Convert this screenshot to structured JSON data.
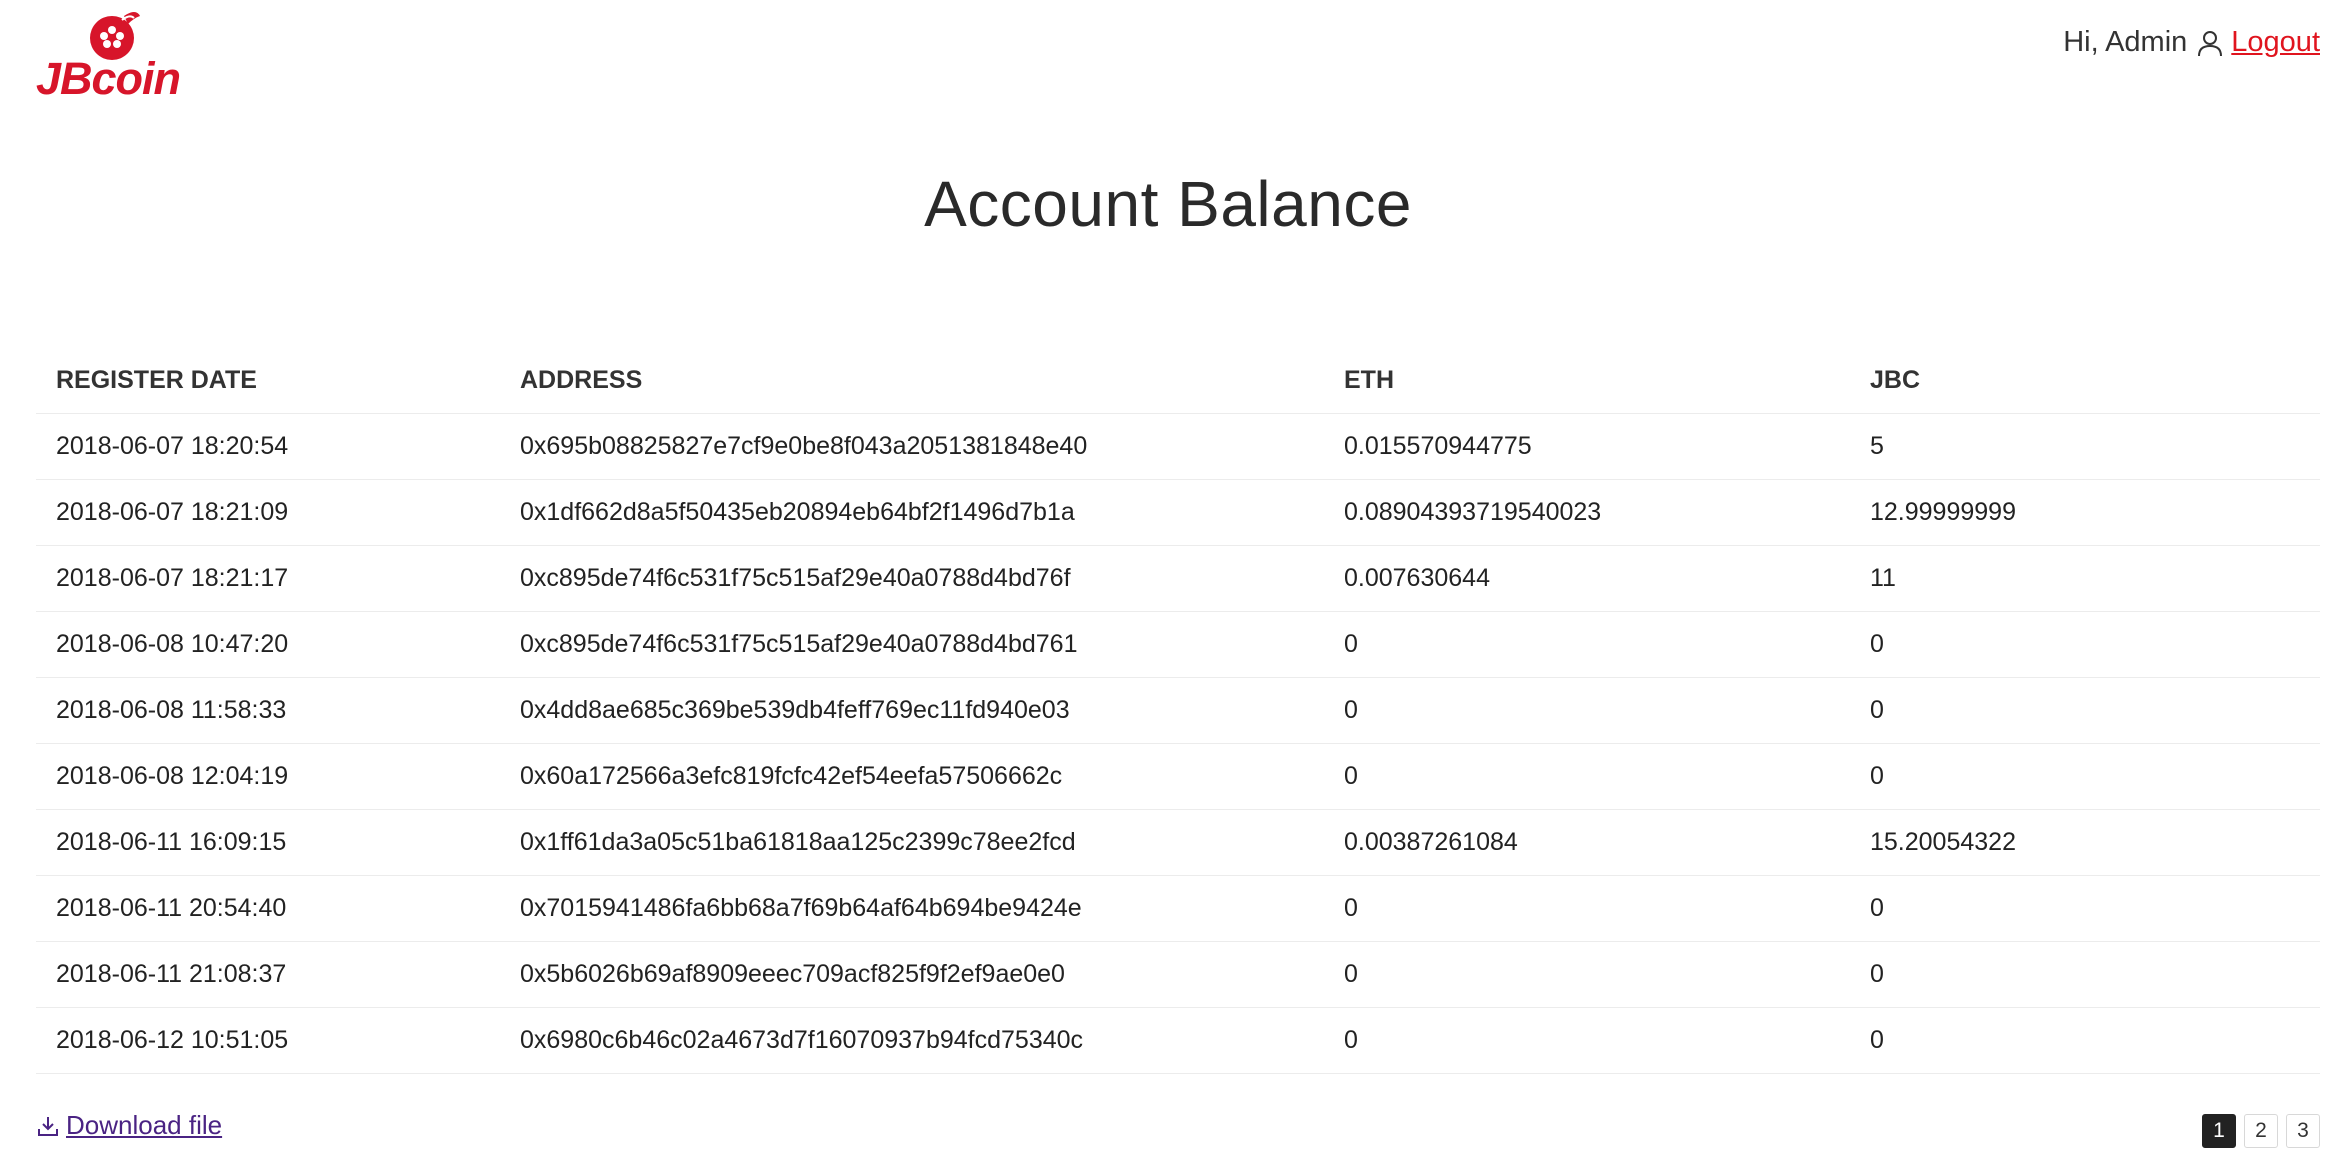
{
  "header": {
    "logo_text": "JBcoin",
    "greeting": "Hi, Admin",
    "logout_label": "Logout"
  },
  "title": "Account Balance",
  "table": {
    "columns": [
      "REGISTER DATE",
      "ADDRESS",
      "ETH",
      "JBC"
    ],
    "rows": [
      [
        "2018-06-07 18:20:54",
        "0x695b08825827e7cf9e0be8f043a2051381848e40",
        "0.015570944775",
        "5"
      ],
      [
        "2018-06-07 18:21:09",
        "0x1df662d8a5f50435eb20894eb64bf2f1496d7b1a",
        "0.08904393719540023",
        "12.99999999"
      ],
      [
        "2018-06-07 18:21:17",
        "0xc895de74f6c531f75c515af29e40a0788d4bd76f",
        "0.007630644",
        "11"
      ],
      [
        "2018-06-08 10:47:20",
        "0xc895de74f6c531f75c515af29e40a0788d4bd761",
        "0",
        "0"
      ],
      [
        "2018-06-08 11:58:33",
        "0x4dd8ae685c369be539db4feff769ec11fd940e03",
        "0",
        "0"
      ],
      [
        "2018-06-08 12:04:19",
        "0x60a172566a3efc819fcfc42ef54eefa57506662c",
        "0",
        "0"
      ],
      [
        "2018-06-11 16:09:15",
        "0x1ff61da3a05c51ba61818aa125c2399c78ee2fcd",
        "0.00387261084",
        "15.20054322"
      ],
      [
        "2018-06-11 20:54:40",
        "0x7015941486fa6bb68a7f69b64af64b694be9424e",
        "0",
        "0"
      ],
      [
        "2018-06-11 21:08:37",
        "0x5b6026b69af8909eeec709acf825f9f2ef9ae0e0",
        "0",
        "0"
      ],
      [
        "2018-06-12 10:51:05",
        "0x6980c6b46c02a4673d7f16070937b94fcd75340c",
        "0",
        "0"
      ]
    ]
  },
  "footer": {
    "download_label": "Download file",
    "pages": [
      "1",
      "2",
      "3"
    ],
    "current_page": "1"
  },
  "colors": {
    "brand": "#d7152a",
    "logout": "#e0141e",
    "download_link": "#4a2383",
    "active_page_bg": "#222222"
  },
  "icons": {
    "logo": "cherry-blossom-logo-icon",
    "user": "user-icon",
    "download": "download-icon"
  }
}
